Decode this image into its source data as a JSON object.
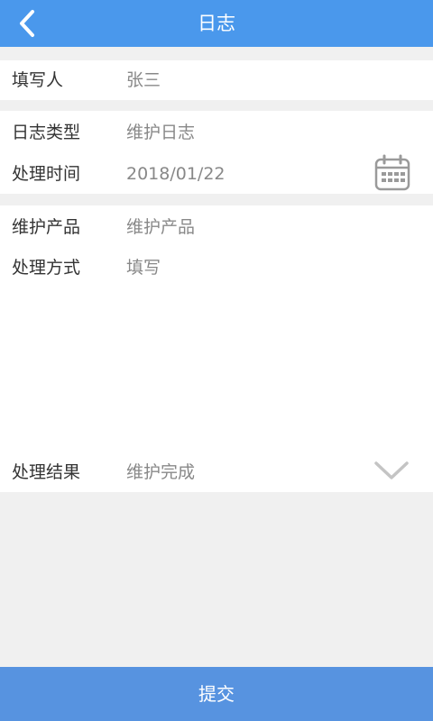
{
  "header": {
    "title": "日志",
    "back_icon": "chevron-left-icon"
  },
  "form": {
    "writer": {
      "label": "填写人",
      "value": "张三"
    },
    "log_type": {
      "label": "日志类型",
      "value": "维护日志"
    },
    "process_time": {
      "label": "处理时间",
      "value": "2018/01/22",
      "icon": "calendar-icon"
    },
    "product": {
      "label": "维护产品",
      "value": "维护产品"
    },
    "method": {
      "label": "处理方式",
      "value": "填写"
    },
    "result": {
      "label": "处理结果",
      "value": "维护完成",
      "icon": "chevron-down-icon"
    }
  },
  "footer": {
    "submit_label": "提交"
  },
  "colors": {
    "header_bg": "#4a98ec",
    "footer_bg": "#5793e0",
    "page_bg": "#f0f0f0"
  }
}
